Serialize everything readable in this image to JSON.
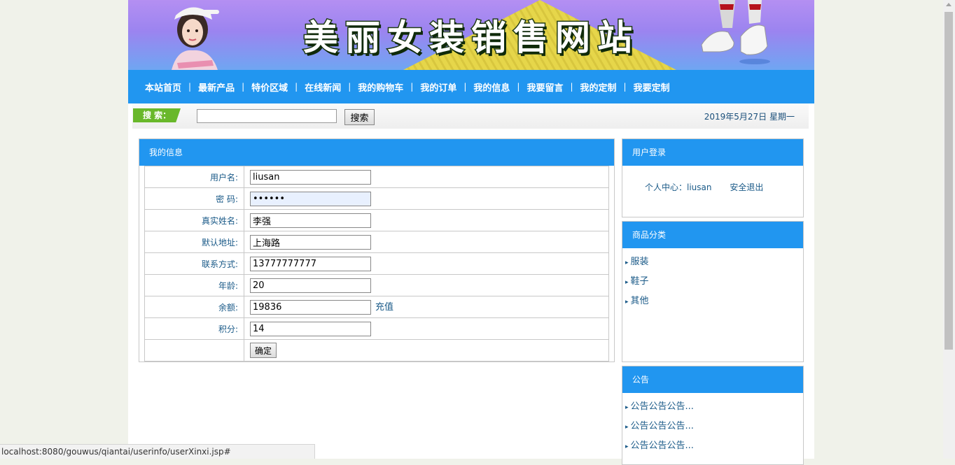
{
  "banner": {
    "title": "美丽女装销售网站"
  },
  "nav": {
    "items": [
      "本站首页",
      "最新产品",
      "特价区域",
      "在线新闻",
      "我的购物车",
      "我的订单",
      "我的信息",
      "我要留言",
      "我的定制",
      "我要定制"
    ]
  },
  "search": {
    "label": "搜 索：",
    "button": "搜索",
    "value": ""
  },
  "date": "2019年5月27日 星期一",
  "main": {
    "title": "我的信息",
    "fields": {
      "username": {
        "label": "用户名:",
        "value": "liusan"
      },
      "password": {
        "label": "密  码:",
        "value": "••••••"
      },
      "realname": {
        "label": "真实姓名:",
        "value": "李强"
      },
      "address": {
        "label": "默认地址:",
        "value": "上海路"
      },
      "contact": {
        "label": "联系方式:",
        "value": "13777777777"
      },
      "age": {
        "label": "年龄:",
        "value": "20"
      },
      "balance": {
        "label": "余额:",
        "value": "19836",
        "link": "充值"
      },
      "points": {
        "label": "积分:",
        "value": "14"
      }
    },
    "submit": "确定"
  },
  "login": {
    "title": "用户登录",
    "center_label": "个人中心：",
    "username": "liusan",
    "logout": "安全退出"
  },
  "categories": {
    "title": "商品分类",
    "items": [
      "服装",
      "鞋子",
      "其他"
    ]
  },
  "notices": {
    "title": "公告",
    "items": [
      "公告公告公告...",
      "公告公告公告...",
      "公告公告公告..."
    ]
  },
  "statusbar": {
    "url": "localhost:8080/gouwus/qiantai/userinfo/userXinxi.jsp#"
  },
  "colors": {
    "nav_blue": "#2196f0",
    "link": "#1a5a88",
    "search_green": "#69b82b"
  }
}
